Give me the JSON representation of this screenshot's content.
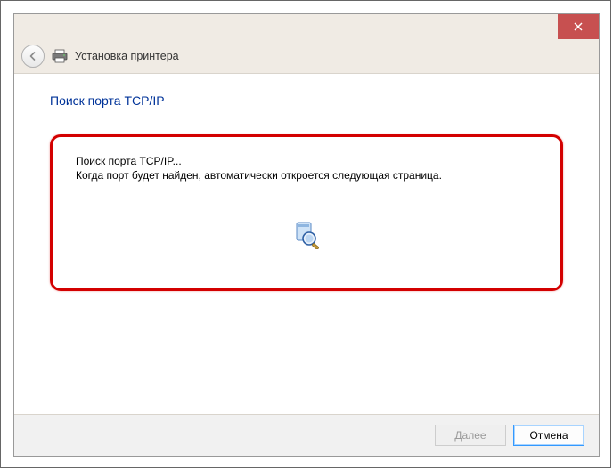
{
  "header": {
    "title": "Установка принтера"
  },
  "page": {
    "heading": "Поиск порта TCP/IP",
    "status_line1": "Поиск порта TCP/IP...",
    "status_line2": "Когда порт будет найден, автоматически откроется следующая страница."
  },
  "buttons": {
    "next": "Далее",
    "cancel": "Отмена"
  }
}
